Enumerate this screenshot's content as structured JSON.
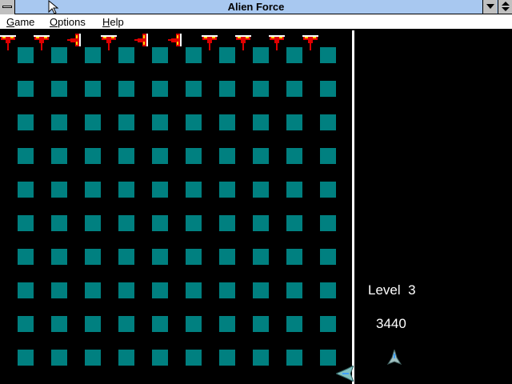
{
  "window": {
    "title": "Alien Force"
  },
  "menu": [
    {
      "mnemonic": "G",
      "rest": "ame"
    },
    {
      "mnemonic": "O",
      "rest": "ptions"
    },
    {
      "mnemonic": "H",
      "rest": "elp"
    }
  ],
  "status": {
    "level_label": "Level",
    "level": "3",
    "score": "3440",
    "lives": 1
  },
  "grid": {
    "rows": 10,
    "cols": 10
  },
  "aliens": [
    {
      "facing": "down"
    },
    {
      "facing": "down"
    },
    {
      "facing": "left"
    },
    {
      "facing": "down"
    },
    {
      "facing": "left"
    },
    {
      "facing": "left"
    },
    {
      "facing": "down"
    },
    {
      "facing": "down"
    },
    {
      "facing": "down"
    },
    {
      "facing": "down"
    }
  ],
  "colors": {
    "block": "#008080",
    "alien_red": "#e00000",
    "alien_yellow": "#ffd000",
    "ship": "#80c0c0",
    "titlebar": "#a8c8f0"
  }
}
